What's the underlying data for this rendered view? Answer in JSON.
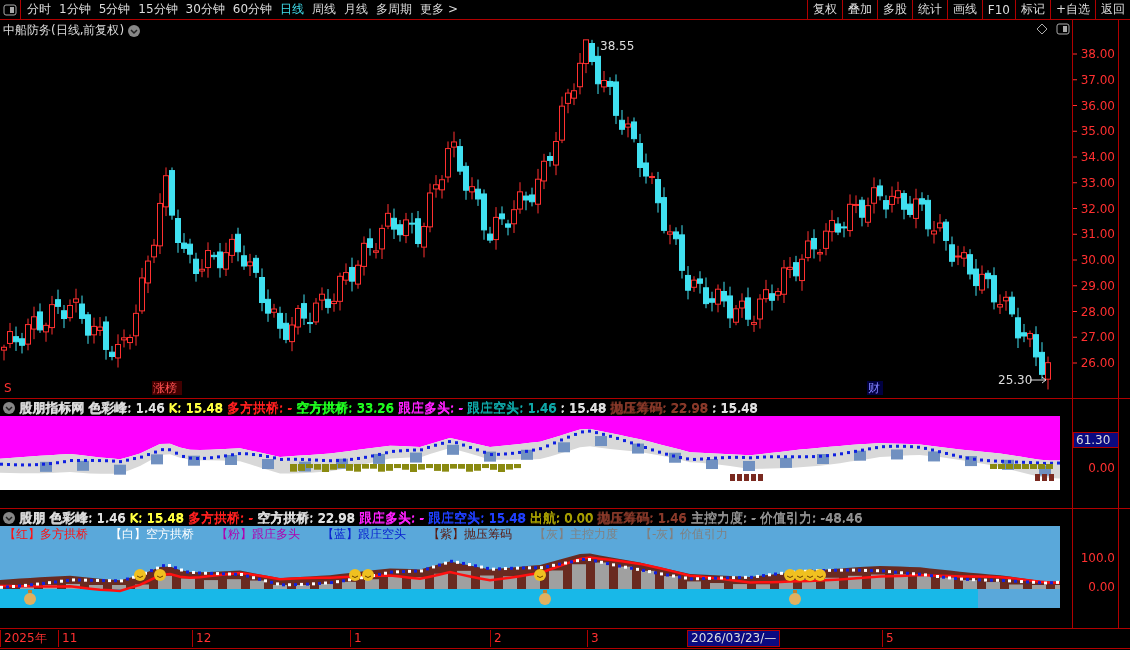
{
  "toolbar": {
    "periods": [
      {
        "label": "分时",
        "selected": false
      },
      {
        "label": "1分钟",
        "selected": false
      },
      {
        "label": "5分钟",
        "selected": false
      },
      {
        "label": "15分钟",
        "selected": false
      },
      {
        "label": "30分钟",
        "selected": false
      },
      {
        "label": "60分钟",
        "selected": false
      },
      {
        "label": "日线",
        "selected": true
      },
      {
        "label": "周线",
        "selected": false
      },
      {
        "label": "月线",
        "selected": false
      },
      {
        "label": "多周期",
        "selected": false
      },
      {
        "label": "更多 >",
        "selected": false
      }
    ],
    "actions": [
      "复权",
      "叠加",
      "多股",
      "统计",
      "画线",
      "F10",
      "标记",
      "+自选",
      "返回"
    ]
  },
  "main_chart": {
    "title": "中船防务(日线,前复权)",
    "high_label": "38.55",
    "low_label": "25.30",
    "markers": [
      {
        "text": "S",
        "kind": "signal"
      },
      {
        "text": "涨榜",
        "kind": "tag"
      },
      {
        "text": "财",
        "kind": "tag"
      }
    ],
    "price_axis": [
      "38.00",
      "37.00",
      "36.00",
      "35.00",
      "34.00",
      "33.00",
      "32.00",
      "31.00",
      "30.00",
      "29.00",
      "28.00",
      "27.00",
      "26.00"
    ]
  },
  "indicator_1": {
    "header": [
      {
        "text": "股朋指标网",
        "color": "#e0e0e0"
      },
      {
        "text": "色彩峰: 1.46",
        "color": "#e0e0e0"
      },
      {
        "text": "K: 15.48",
        "color": "#ffff40"
      },
      {
        "text": "多方拱桥: -",
        "color": "#ff2020"
      },
      {
        "text": "空方拱桥: 33.26",
        "color": "#20ff20"
      },
      {
        "text": "跟庄多头: -",
        "color": "#ff20ff"
      },
      {
        "text": "跟庄空头: 1.46",
        "color": "#10a8a8"
      },
      {
        "text": ": 15.48",
        "color": "#e0e0e0"
      },
      {
        "text": "抛压筹码: 22.98",
        "color": "#8a3a2a"
      },
      {
        "text": ": 15.48",
        "color": "#e0e0e0"
      }
    ],
    "axis": [
      {
        "text": "61.30",
        "kind": "cursor"
      },
      {
        "text": "0.00",
        "kind": "tick"
      }
    ]
  },
  "indicator_2": {
    "header": [
      {
        "text": "股朋",
        "color": "#e0e0e0"
      },
      {
        "text": "色彩峰: 1.46",
        "color": "#e0e0e0"
      },
      {
        "text": "K: 15.48",
        "color": "#ffff40"
      },
      {
        "text": "多方拱桥: -",
        "color": "#ff2020"
      },
      {
        "text": "空方拱桥: 22.98",
        "color": "#e0e0e0"
      },
      {
        "text": "跟庄多头: -",
        "color": "#ff20ff"
      },
      {
        "text": "跟庄空头: 15.48",
        "color": "#2040ff"
      },
      {
        "text": "出航: 0.00",
        "color": "#a8a000"
      },
      {
        "text": "抛压筹码: 1.46",
        "color": "#8a3a2a"
      },
      {
        "text": "主控力度: -",
        "color": "#909090"
      },
      {
        "text": "价值引力: -48.46",
        "color": "#909090"
      }
    ],
    "legend": [
      {
        "text": "【红】多方拱桥",
        "color": "#ff1010"
      },
      {
        "text": "【白】空方拱桥",
        "color": "#ffffff"
      },
      {
        "text": "【粉】跟庄多头",
        "color": "#b000b0"
      },
      {
        "text": "【蓝】跟庄空头",
        "color": "#0820d0"
      },
      {
        "text": "【紫】抛压筹码",
        "color": "#5a1a10"
      },
      {
        "text": "【灰】主控力度",
        "color": "#808080"
      },
      {
        "text": "【-灰】价值引力",
        "color": "#808080"
      }
    ],
    "axis": [
      {
        "text": "100.0",
        "kind": "tick"
      },
      {
        "text": "0.00",
        "kind": "tick"
      }
    ]
  },
  "time_axis": [
    {
      "text": "2025年",
      "kind": "tick"
    },
    {
      "text": "11",
      "kind": "tick"
    },
    {
      "text": "12",
      "kind": "tick"
    },
    {
      "text": "1",
      "kind": "tick"
    },
    {
      "text": "2",
      "kind": "tick"
    },
    {
      "text": "3",
      "kind": "tick"
    },
    {
      "text": "2026/03/23/—",
      "kind": "cursor"
    },
    {
      "text": "5",
      "kind": "tick"
    }
  ]
}
